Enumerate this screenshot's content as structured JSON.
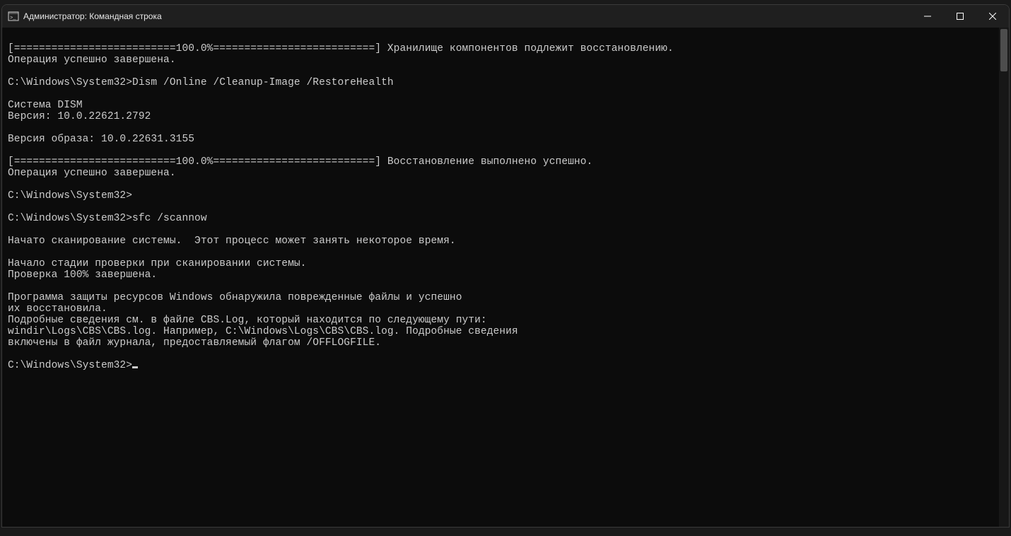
{
  "titlebar": {
    "title": "Администратор: Командная строка"
  },
  "terminal": {
    "lines": [
      "",
      "[==========================100.0%==========================] Хранилище компонентов подлежит восстановлению.",
      "Операция успешно завершена.",
      "",
      "C:\\Windows\\System32>Dism /Online /Cleanup-Image /RestoreHealth",
      "",
      "Cистема DISM",
      "Версия: 10.0.22621.2792",
      "",
      "Версия образа: 10.0.22631.3155",
      "",
      "[==========================100.0%==========================] Восстановление выполнено успешно.",
      "Операция успешно завершена.",
      "",
      "C:\\Windows\\System32>",
      "",
      "C:\\Windows\\System32>sfc /scannow",
      "",
      "Начато сканирование системы.  Этот процесс может занять некоторое время.",
      "",
      "Начало стадии проверки при сканировании системы.",
      "Проверка 100% завершена.",
      "",
      "Программа защиты ресурсов Windows обнаружила поврежденные файлы и успешно",
      "их восстановила.",
      "Подробные сведения см. в файле CBS.Log, который находится по следующему пути:",
      "windir\\Logs\\CBS\\CBS.log. Например, C:\\Windows\\Logs\\CBS\\CBS.log. Подробные сведения",
      "включены в файл журнала, предоставляемый флагом /OFFLOGFILE.",
      "",
      "C:\\Windows\\System32>"
    ]
  }
}
